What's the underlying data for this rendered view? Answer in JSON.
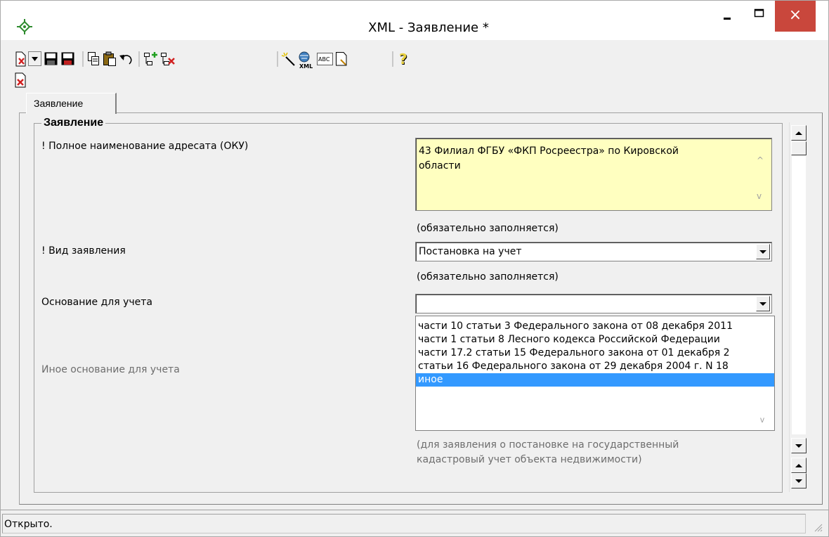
{
  "window": {
    "title": "XML - Заявление *",
    "close_glyph": "×"
  },
  "toolbar": {
    "buttons": [
      "new-document-icon",
      "dropdown-arrow-icon",
      "save-icon",
      "save-as-icon",
      "copy-icon",
      "paste-icon",
      "undo-icon",
      "add-node-icon",
      "delete-node-icon",
      "magic-wand-icon",
      "xml-icon",
      "spellcheck-icon",
      "page-icon",
      "help-icon"
    ],
    "abc_label": "ABC",
    "xml_label": "XML",
    "help_glyph": "?"
  },
  "tabs": [
    {
      "label": "Заявление",
      "active": true
    }
  ],
  "form": {
    "group_title": "Заявление",
    "addressee": {
      "label": "! Полное наименование адресата (ОКУ)",
      "value": "43 Филиал ФГБУ «ФКП Росреестра» по Кировской области",
      "hint": "(обязательно заполняется)"
    },
    "statement_type": {
      "label": "! Вид заявления",
      "value": "Постановка на учет",
      "hint": "(обязательно заполняется)"
    },
    "basis": {
      "label": "Основание для учета",
      "value": "",
      "options": [
        "части 10 статьи 3 Федерального закона от 08 декабря 2011",
        "части 1 статьи 8 Лесного кодекса Российской Федерации",
        "части 17.2 статьи 15 Федерального закона от 01 декабря 2",
        "статьи 16 Федерального закона от 29 декабря 2004 г. N 18",
        "иное"
      ],
      "selected_option": "иное"
    },
    "other_basis": {
      "label": "Иное основание для учета",
      "hint_line1": "(для заявления о постановке на государственный",
      "hint_line2": "кадастровый учет объекта недвижимости)"
    }
  },
  "status": {
    "text": "Открыто."
  },
  "colors": {
    "memo_background": "#ffffc0",
    "selection": "#3399ff",
    "close_button": "#c9473c"
  }
}
